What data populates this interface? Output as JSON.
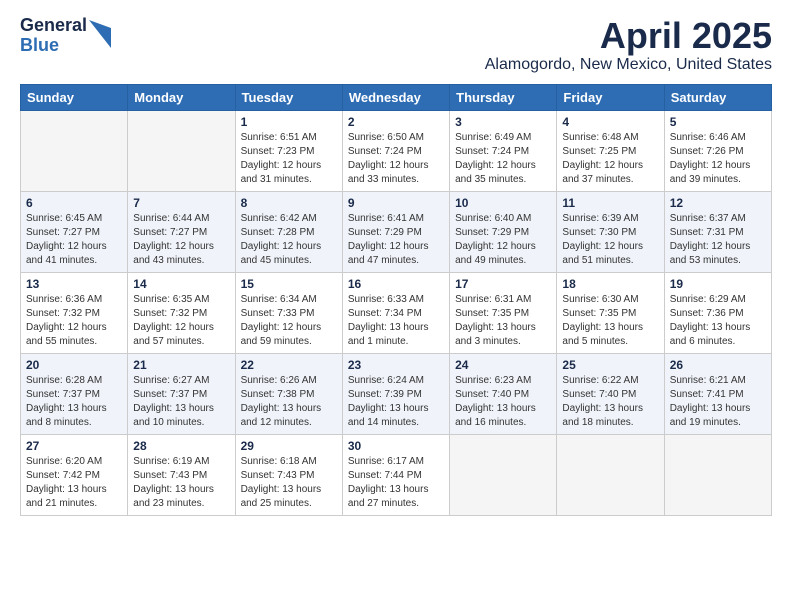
{
  "logo": {
    "general": "General",
    "blue": "Blue"
  },
  "title": {
    "month": "April 2025",
    "location": "Alamogordo, New Mexico, United States"
  },
  "weekdays": [
    "Sunday",
    "Monday",
    "Tuesday",
    "Wednesday",
    "Thursday",
    "Friday",
    "Saturday"
  ],
  "weeks": [
    [
      {
        "day": "",
        "info": ""
      },
      {
        "day": "",
        "info": ""
      },
      {
        "day": "1",
        "info": "Sunrise: 6:51 AM\nSunset: 7:23 PM\nDaylight: 12 hours\nand 31 minutes."
      },
      {
        "day": "2",
        "info": "Sunrise: 6:50 AM\nSunset: 7:24 PM\nDaylight: 12 hours\nand 33 minutes."
      },
      {
        "day": "3",
        "info": "Sunrise: 6:49 AM\nSunset: 7:24 PM\nDaylight: 12 hours\nand 35 minutes."
      },
      {
        "day": "4",
        "info": "Sunrise: 6:48 AM\nSunset: 7:25 PM\nDaylight: 12 hours\nand 37 minutes."
      },
      {
        "day": "5",
        "info": "Sunrise: 6:46 AM\nSunset: 7:26 PM\nDaylight: 12 hours\nand 39 minutes."
      }
    ],
    [
      {
        "day": "6",
        "info": "Sunrise: 6:45 AM\nSunset: 7:27 PM\nDaylight: 12 hours\nand 41 minutes."
      },
      {
        "day": "7",
        "info": "Sunrise: 6:44 AM\nSunset: 7:27 PM\nDaylight: 12 hours\nand 43 minutes."
      },
      {
        "day": "8",
        "info": "Sunrise: 6:42 AM\nSunset: 7:28 PM\nDaylight: 12 hours\nand 45 minutes."
      },
      {
        "day": "9",
        "info": "Sunrise: 6:41 AM\nSunset: 7:29 PM\nDaylight: 12 hours\nand 47 minutes."
      },
      {
        "day": "10",
        "info": "Sunrise: 6:40 AM\nSunset: 7:29 PM\nDaylight: 12 hours\nand 49 minutes."
      },
      {
        "day": "11",
        "info": "Sunrise: 6:39 AM\nSunset: 7:30 PM\nDaylight: 12 hours\nand 51 minutes."
      },
      {
        "day": "12",
        "info": "Sunrise: 6:37 AM\nSunset: 7:31 PM\nDaylight: 12 hours\nand 53 minutes."
      }
    ],
    [
      {
        "day": "13",
        "info": "Sunrise: 6:36 AM\nSunset: 7:32 PM\nDaylight: 12 hours\nand 55 minutes."
      },
      {
        "day": "14",
        "info": "Sunrise: 6:35 AM\nSunset: 7:32 PM\nDaylight: 12 hours\nand 57 minutes."
      },
      {
        "day": "15",
        "info": "Sunrise: 6:34 AM\nSunset: 7:33 PM\nDaylight: 12 hours\nand 59 minutes."
      },
      {
        "day": "16",
        "info": "Sunrise: 6:33 AM\nSunset: 7:34 PM\nDaylight: 13 hours\nand 1 minute."
      },
      {
        "day": "17",
        "info": "Sunrise: 6:31 AM\nSunset: 7:35 PM\nDaylight: 13 hours\nand 3 minutes."
      },
      {
        "day": "18",
        "info": "Sunrise: 6:30 AM\nSunset: 7:35 PM\nDaylight: 13 hours\nand 5 minutes."
      },
      {
        "day": "19",
        "info": "Sunrise: 6:29 AM\nSunset: 7:36 PM\nDaylight: 13 hours\nand 6 minutes."
      }
    ],
    [
      {
        "day": "20",
        "info": "Sunrise: 6:28 AM\nSunset: 7:37 PM\nDaylight: 13 hours\nand 8 minutes."
      },
      {
        "day": "21",
        "info": "Sunrise: 6:27 AM\nSunset: 7:37 PM\nDaylight: 13 hours\nand 10 minutes."
      },
      {
        "day": "22",
        "info": "Sunrise: 6:26 AM\nSunset: 7:38 PM\nDaylight: 13 hours\nand 12 minutes."
      },
      {
        "day": "23",
        "info": "Sunrise: 6:24 AM\nSunset: 7:39 PM\nDaylight: 13 hours\nand 14 minutes."
      },
      {
        "day": "24",
        "info": "Sunrise: 6:23 AM\nSunset: 7:40 PM\nDaylight: 13 hours\nand 16 minutes."
      },
      {
        "day": "25",
        "info": "Sunrise: 6:22 AM\nSunset: 7:40 PM\nDaylight: 13 hours\nand 18 minutes."
      },
      {
        "day": "26",
        "info": "Sunrise: 6:21 AM\nSunset: 7:41 PM\nDaylight: 13 hours\nand 19 minutes."
      }
    ],
    [
      {
        "day": "27",
        "info": "Sunrise: 6:20 AM\nSunset: 7:42 PM\nDaylight: 13 hours\nand 21 minutes."
      },
      {
        "day": "28",
        "info": "Sunrise: 6:19 AM\nSunset: 7:43 PM\nDaylight: 13 hours\nand 23 minutes."
      },
      {
        "day": "29",
        "info": "Sunrise: 6:18 AM\nSunset: 7:43 PM\nDaylight: 13 hours\nand 25 minutes."
      },
      {
        "day": "30",
        "info": "Sunrise: 6:17 AM\nSunset: 7:44 PM\nDaylight: 13 hours\nand 27 minutes."
      },
      {
        "day": "",
        "info": ""
      },
      {
        "day": "",
        "info": ""
      },
      {
        "day": "",
        "info": ""
      }
    ]
  ]
}
